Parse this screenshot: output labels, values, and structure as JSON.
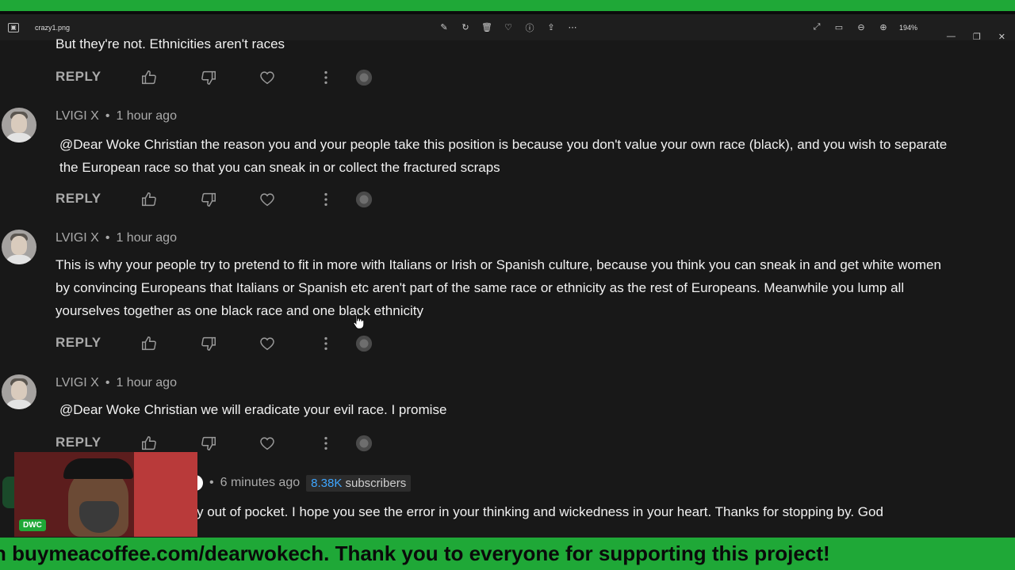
{
  "viewer": {
    "file_name": "crazy1.png",
    "zoom_level": "194%",
    "toolbar_icons": [
      "edit-icon",
      "rotate-icon",
      "delete-icon",
      "heart-icon",
      "info-icon",
      "share-icon",
      "more-icon"
    ],
    "right_icons": [
      "fullscreen-icon",
      "fit-icon",
      "zoom-out-icon",
      "zoom-in-icon"
    ]
  },
  "top_comment_text": "But they're not. Ethnicities aren't races",
  "reply_label": "REPLY",
  "comments": [
    {
      "author": "LVIGI X",
      "time": "1 hour ago",
      "text": "@Dear Woke Christian  the reason you and your people take this position is because you don't value your own race (black), and you wish to separate the European race so that you can sneak in or collect the fractured scraps"
    },
    {
      "author": "LVIGI X",
      "time": "1 hour ago",
      "text": "This is why your people try to pretend to fit in more with Italians or Irish or Spanish culture, because you think you can sneak in and get white women by convincing Europeans that Italians or Spanish etc aren't part of the same race or ethnicity as the rest of Europeans. Meanwhile you lump all yourselves together as one black race and one black ethnicity"
    },
    {
      "author": "LVIGI X",
      "time": "1 hour ago",
      "text": "@Dear Woke Christian  we will eradicate your evil race. I promise"
    }
  ],
  "last_comment": {
    "time": "6 minutes ago",
    "subscribers_num": "8.38K",
    "subscribers_label": "subscribers",
    "text": "y out of pocket. I hope you see the error in your thinking and wickedness in your heart. Thanks for stopping by. God"
  },
  "webcam_badge": "DWC",
  "ticker_text": "n buymeacoffee.com/dearwokech. Thank you to everyone for supporting this project!",
  "colors": {
    "stream_green": "#1fa837",
    "background": "#181818",
    "link_blue": "#3ea6ff"
  }
}
